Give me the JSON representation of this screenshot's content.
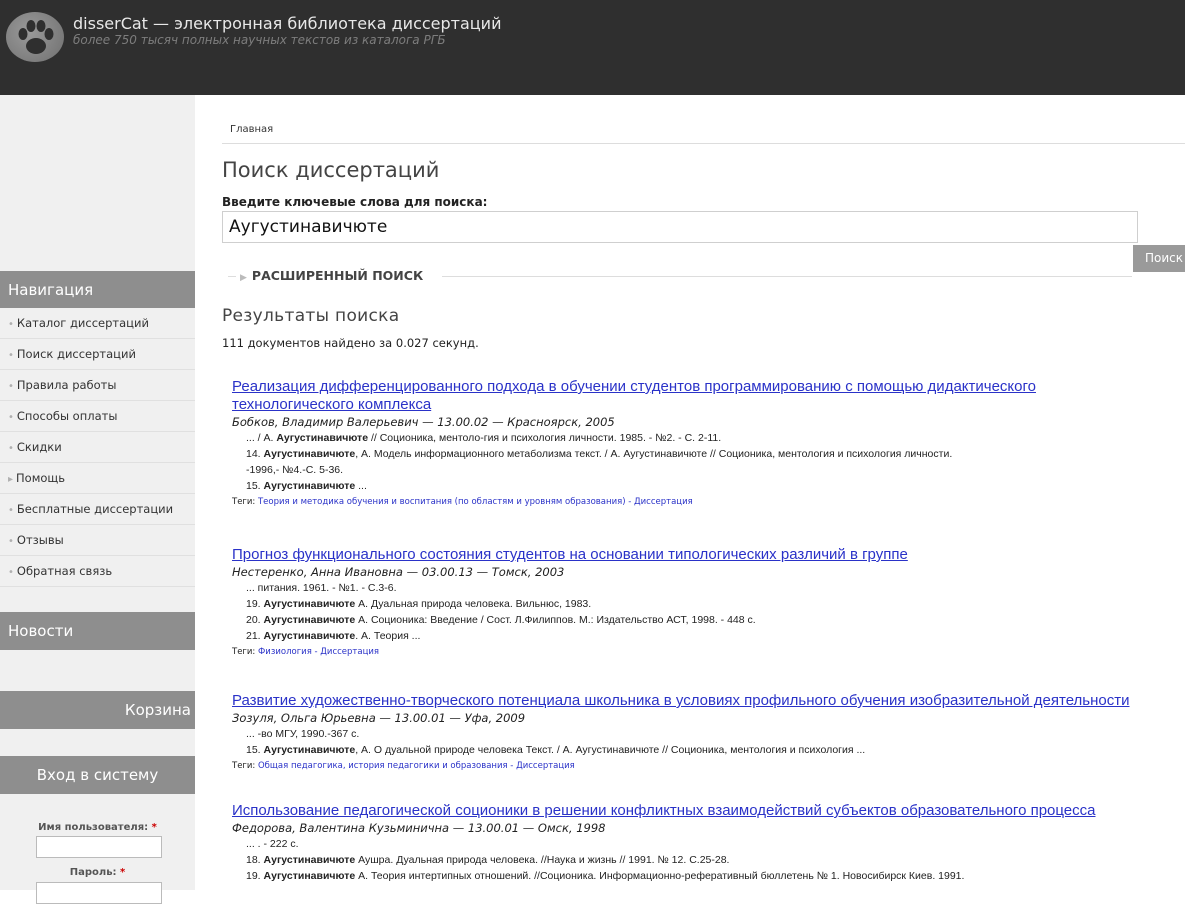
{
  "header": {
    "title": "disserCat — электронная библиотека диссертаций",
    "subtitle": "более 750 тысяч полных научных текстов из каталога РГБ",
    "logo_icon": "paw-icon"
  },
  "breadcrumb": "Главная",
  "page_title": "Поиск диссертаций",
  "search": {
    "label": "Введите ключевые слова для поиска:",
    "value": "Аугустинавичюте",
    "button_label": "Поиск",
    "advanced_label": "РАСШИРЕННЫЙ ПОИСК"
  },
  "results": {
    "title": "Результаты поиска",
    "count_text": "111 документов найдено за 0.027 секунд.",
    "items": [
      {
        "title_lines": [
          "Реализация дифференцированного подхода в обучении студентов программированию с помощью дидактического",
          "технологического комплекса"
        ],
        "author": "Бобков, Владимир Валерьевич — 13.00.02 — Красноярск, 2005",
        "snippets": [
          {
            "pre": "... / А. ",
            "bold": "Аугустинавичюте",
            "post": " // Соционика, ментоло-гия и психология личности. 1985. - №2. - С. 2-11.",
            "indent": true
          },
          {
            "pre": "14. ",
            "bold": "Аугустинавичюте",
            "post": ", А. Модель информационного метаболизма текст. / А. Аугустинавичюте // Соционика, ментология и психология личности.",
            "indent": false
          },
          {
            "pre": "-1996,- №4.-С. 5-36.",
            "bold": "",
            "post": "",
            "indent": false
          },
          {
            "pre": "15. ",
            "bold": "Аугустинавичюте",
            "post": " ...",
            "indent": false
          }
        ],
        "tags_label": "Теги:",
        "tags": "Теория и методика обучения и воспитания (по областям и уровням образования) - Диссертация"
      },
      {
        "title_lines": [
          "Прогноз функционального состояния студентов на основании типологических различий в группе"
        ],
        "author": "Нестеренко, Анна Ивановна — 03.00.13 — Томск, 2003",
        "snippets": [
          {
            "pre": "... питания. 1961. - №1. - С.3-6.",
            "bold": "",
            "post": "",
            "indent": true
          },
          {
            "pre": "19. ",
            "bold": "Аугустинавичюте",
            "post": " А. Дуальная природа человека. Вильнюс, 1983.",
            "indent": false
          },
          {
            "pre": "20. ",
            "bold": "Аугустинавичюте",
            "post": " А. Соционика: Введение / Сост. Л.Филиппов. М.: Издательство АСТ, 1998. - 448 с.",
            "indent": false
          },
          {
            "pre": "21. ",
            "bold": "Аугустинавичюте",
            "post": ". А. Теория ...",
            "indent": false
          }
        ],
        "tags_label": "Теги:",
        "tags": "Физиология - Диссертация"
      },
      {
        "title_lines": [
          "Развитие художественно-творческого потенциала школьника в условиях профильного обучения изобразительной деятельности"
        ],
        "author": "Зозуля, Ольга Юрьевна — 13.00.01 — Уфа, 2009",
        "snippets": [
          {
            "pre": "... -во МГУ, 1990.-367 с.",
            "bold": "",
            "post": "",
            "indent": true
          },
          {
            "pre": "15. ",
            "bold": "Аугустинавичюте",
            "post": ", А. О дуальной природе человека Текст. / А. Аугустинавичюте // Соционика, ментология и психология ...",
            "indent": false
          }
        ],
        "tags_label": "Теги:",
        "tags": "Общая педагогика, история педагогики и образования - Диссертация"
      },
      {
        "title_lines": [
          "Использование педагогической соционики в решении конфликтных взаимодействий субъектов образовательного процесса"
        ],
        "author": "Федорова, Валентина Кузьминична — 13.00.01 — Омск, 1998",
        "snippets": [
          {
            "pre": "... . - 222 с.",
            "bold": "",
            "post": "",
            "indent": true
          },
          {
            "pre": "18. ",
            "bold": "Аугустинавичюте",
            "post": " Аушра. Дуальная природа человека. //Наука и жизнь // 1991. № 12. С.25-28.",
            "indent": false
          },
          {
            "pre": "19. ",
            "bold": "Аугустинавичюте",
            "post": " А. Теория интертипных отношений. //Соционика. Информационно-реферативный бюллетень № 1. Новосибирск Киев. 1991.",
            "indent": false
          }
        ],
        "tags_label": "",
        "tags": ""
      }
    ]
  },
  "sidebar": {
    "nav_heading": "Навигация",
    "nav_items": [
      {
        "label": "Каталог диссертаций",
        "bullet": "•"
      },
      {
        "label": "Поиск диссертаций",
        "bullet": "•"
      },
      {
        "label": "Правила работы",
        "bullet": "•"
      },
      {
        "label": "Способы оплаты",
        "bullet": "•"
      },
      {
        "label": "Скидки",
        "bullet": "•"
      },
      {
        "label": "Помощь",
        "bullet": "▸"
      },
      {
        "label": "Бесплатные диссертации",
        "bullet": "•"
      },
      {
        "label": "Отзывы",
        "bullet": "•"
      },
      {
        "label": "Обратная связь",
        "bullet": "•"
      }
    ],
    "news_heading": "Новости",
    "cart_heading": "Корзина",
    "login_heading": "Вход в систему",
    "username_label": "Имя пользователя:",
    "password_label": "Пароль:",
    "required_mark": "*"
  },
  "colors": {
    "header_bg": "#2f2f2f",
    "sidebar_heading_bg": "#8e8e8e",
    "link": "#2a32c8"
  }
}
